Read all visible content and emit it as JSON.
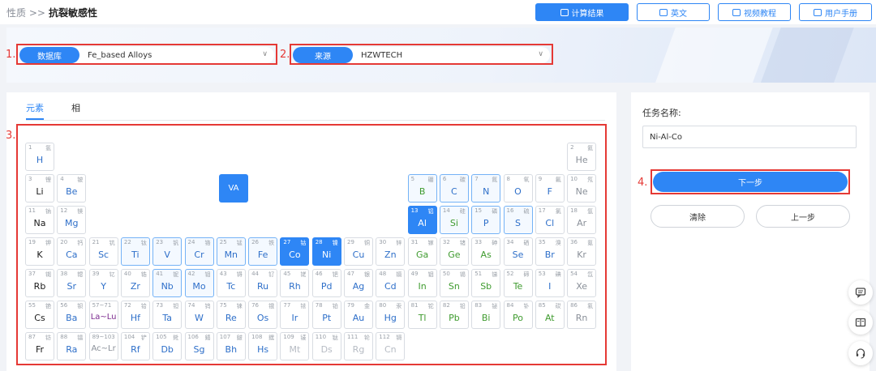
{
  "breadcrumb": {
    "parent": "性质 >>",
    "current": "抗裂敏感性"
  },
  "toolbar": {
    "calc": "计算结果",
    "english": "英文",
    "video": "视频教程",
    "manual": "用户手册"
  },
  "steps": {
    "s1": "1.",
    "s2": "2.",
    "s3": "3.",
    "s4": "4."
  },
  "database": {
    "label": "数据库",
    "value": "Fe_based Alloys"
  },
  "source": {
    "label": "来源",
    "value": "HZWTECH"
  },
  "tabs": {
    "elements": "元素",
    "phase": "相"
  },
  "va_button": "VA",
  "task": {
    "label": "任务名称:",
    "value": "Ni-Al-Co"
  },
  "actions": {
    "next": "下一步",
    "clear": "清除",
    "prev": "上一步"
  },
  "colors": {
    "accent": "#2e86f5",
    "alert": "#e53935"
  },
  "elements": [
    {
      "z": "1",
      "cn": "氢",
      "s": "H",
      "r": 0,
      "c": 0,
      "t": "b"
    },
    {
      "z": "2",
      "cn": "氦",
      "s": "He",
      "r": 0,
      "c": 17,
      "t": "g"
    },
    {
      "z": "3",
      "cn": "锂",
      "s": "Li",
      "r": 1,
      "c": 0,
      "t": "k"
    },
    {
      "z": "4",
      "cn": "铍",
      "s": "Be",
      "r": 1,
      "c": 1,
      "t": "b"
    },
    {
      "z": "5",
      "cn": "硼",
      "s": "B",
      "r": 1,
      "c": 12,
      "t": "gr",
      "h": 1
    },
    {
      "z": "6",
      "cn": "碳",
      "s": "C",
      "r": 1,
      "c": 13,
      "t": "b",
      "h": 1
    },
    {
      "z": "7",
      "cn": "氮",
      "s": "N",
      "r": 1,
      "c": 14,
      "t": "b",
      "h": 1
    },
    {
      "z": "8",
      "cn": "氧",
      "s": "O",
      "r": 1,
      "c": 15,
      "t": "b"
    },
    {
      "z": "9",
      "cn": "氟",
      "s": "F",
      "r": 1,
      "c": 16,
      "t": "b"
    },
    {
      "z": "10",
      "cn": "氖",
      "s": "Ne",
      "r": 1,
      "c": 17,
      "t": "g"
    },
    {
      "z": "11",
      "cn": "钠",
      "s": "Na",
      "r": 2,
      "c": 0,
      "t": "k"
    },
    {
      "z": "12",
      "cn": "镁",
      "s": "Mg",
      "r": 2,
      "c": 1,
      "t": "b"
    },
    {
      "z": "13",
      "cn": "铝",
      "s": "Al",
      "r": 2,
      "c": 12,
      "t": "w",
      "sel": 1
    },
    {
      "z": "14",
      "cn": "硅",
      "s": "Si",
      "r": 2,
      "c": 13,
      "t": "gr",
      "h": 1
    },
    {
      "z": "15",
      "cn": "磷",
      "s": "P",
      "r": 2,
      "c": 14,
      "t": "b",
      "h": 1
    },
    {
      "z": "16",
      "cn": "硫",
      "s": "S",
      "r": 2,
      "c": 15,
      "t": "b",
      "h": 1
    },
    {
      "z": "17",
      "cn": "氯",
      "s": "Cl",
      "r": 2,
      "c": 16,
      "t": "b"
    },
    {
      "z": "18",
      "cn": "氩",
      "s": "Ar",
      "r": 2,
      "c": 17,
      "t": "g"
    },
    {
      "z": "19",
      "cn": "钾",
      "s": "K",
      "r": 3,
      "c": 0,
      "t": "k"
    },
    {
      "z": "20",
      "cn": "钙",
      "s": "Ca",
      "r": 3,
      "c": 1,
      "t": "b"
    },
    {
      "z": "21",
      "cn": "钪",
      "s": "Sc",
      "r": 3,
      "c": 2,
      "t": "b"
    },
    {
      "z": "22",
      "cn": "钛",
      "s": "Ti",
      "r": 3,
      "c": 3,
      "t": "b",
      "h": 1
    },
    {
      "z": "23",
      "cn": "钒",
      "s": "V",
      "r": 3,
      "c": 4,
      "t": "b",
      "h": 1
    },
    {
      "z": "24",
      "cn": "铬",
      "s": "Cr",
      "r": 3,
      "c": 5,
      "t": "b",
      "h": 1
    },
    {
      "z": "25",
      "cn": "锰",
      "s": "Mn",
      "r": 3,
      "c": 6,
      "t": "b",
      "h": 1
    },
    {
      "z": "26",
      "cn": "铁",
      "s": "Fe",
      "r": 3,
      "c": 7,
      "t": "b",
      "h": 1
    },
    {
      "z": "27",
      "cn": "钴",
      "s": "Co",
      "r": 3,
      "c": 8,
      "t": "w",
      "sel": 1
    },
    {
      "z": "28",
      "cn": "镍",
      "s": "Ni",
      "r": 3,
      "c": 9,
      "t": "w",
      "sel": 1
    },
    {
      "z": "29",
      "cn": "铜",
      "s": "Cu",
      "r": 3,
      "c": 10,
      "t": "b"
    },
    {
      "z": "30",
      "cn": "锌",
      "s": "Zn",
      "r": 3,
      "c": 11,
      "t": "b"
    },
    {
      "z": "31",
      "cn": "镓",
      "s": "Ga",
      "r": 3,
      "c": 12,
      "t": "gr"
    },
    {
      "z": "32",
      "cn": "锗",
      "s": "Ge",
      "r": 3,
      "c": 13,
      "t": "gr"
    },
    {
      "z": "33",
      "cn": "砷",
      "s": "As",
      "r": 3,
      "c": 14,
      "t": "gr"
    },
    {
      "z": "34",
      "cn": "硒",
      "s": "Se",
      "r": 3,
      "c": 15,
      "t": "b"
    },
    {
      "z": "35",
      "cn": "溴",
      "s": "Br",
      "r": 3,
      "c": 16,
      "t": "b"
    },
    {
      "z": "36",
      "cn": "氪",
      "s": "Kr",
      "r": 3,
      "c": 17,
      "t": "g"
    },
    {
      "z": "37",
      "cn": "铷",
      "s": "Rb",
      "r": 4,
      "c": 0,
      "t": "k"
    },
    {
      "z": "38",
      "cn": "锶",
      "s": "Sr",
      "r": 4,
      "c": 1,
      "t": "b"
    },
    {
      "z": "39",
      "cn": "钇",
      "s": "Y",
      "r": 4,
      "c": 2,
      "t": "b"
    },
    {
      "z": "40",
      "cn": "锆",
      "s": "Zr",
      "r": 4,
      "c": 3,
      "t": "b"
    },
    {
      "z": "41",
      "cn": "铌",
      "s": "Nb",
      "r": 4,
      "c": 4,
      "t": "b",
      "h": 1
    },
    {
      "z": "42",
      "cn": "钼",
      "s": "Mo",
      "r": 4,
      "c": 5,
      "t": "b",
      "h": 1
    },
    {
      "z": "43",
      "cn": "锝",
      "s": "Tc",
      "r": 4,
      "c": 6,
      "t": "b"
    },
    {
      "z": "44",
      "cn": "钌",
      "s": "Ru",
      "r": 4,
      "c": 7,
      "t": "b"
    },
    {
      "z": "45",
      "cn": "铑",
      "s": "Rh",
      "r": 4,
      "c": 8,
      "t": "b"
    },
    {
      "z": "46",
      "cn": "钯",
      "s": "Pd",
      "r": 4,
      "c": 9,
      "t": "b"
    },
    {
      "z": "47",
      "cn": "银",
      "s": "Ag",
      "r": 4,
      "c": 10,
      "t": "b"
    },
    {
      "z": "48",
      "cn": "镉",
      "s": "Cd",
      "r": 4,
      "c": 11,
      "t": "b"
    },
    {
      "z": "49",
      "cn": "铟",
      "s": "In",
      "r": 4,
      "c": 12,
      "t": "gr"
    },
    {
      "z": "50",
      "cn": "锡",
      "s": "Sn",
      "r": 4,
      "c": 13,
      "t": "gr"
    },
    {
      "z": "51",
      "cn": "锑",
      "s": "Sb",
      "r": 4,
      "c": 14,
      "t": "gr"
    },
    {
      "z": "52",
      "cn": "碲",
      "s": "Te",
      "r": 4,
      "c": 15,
      "t": "gr"
    },
    {
      "z": "53",
      "cn": "碘",
      "s": "I",
      "r": 4,
      "c": 16,
      "t": "b"
    },
    {
      "z": "54",
      "cn": "氙",
      "s": "Xe",
      "r": 4,
      "c": 17,
      "t": "g"
    },
    {
      "z": "55",
      "cn": "铯",
      "s": "Cs",
      "r": 5,
      "c": 0,
      "t": "k"
    },
    {
      "z": "56",
      "cn": "钡",
      "s": "Ba",
      "r": 5,
      "c": 1,
      "t": "b"
    },
    {
      "z": "57~71",
      "cn": "",
      "s": "La~Lu",
      "r": 5,
      "c": 2,
      "t": "p"
    },
    {
      "z": "72",
      "cn": "铪",
      "s": "Hf",
      "r": 5,
      "c": 3,
      "t": "b"
    },
    {
      "z": "73",
      "cn": "钽",
      "s": "Ta",
      "r": 5,
      "c": 4,
      "t": "b"
    },
    {
      "z": "74",
      "cn": "钨",
      "s": "W",
      "r": 5,
      "c": 5,
      "t": "b"
    },
    {
      "z": "75",
      "cn": "铼",
      "s": "Re",
      "r": 5,
      "c": 6,
      "t": "b"
    },
    {
      "z": "76",
      "cn": "锇",
      "s": "Os",
      "r": 5,
      "c": 7,
      "t": "b"
    },
    {
      "z": "77",
      "cn": "铱",
      "s": "Ir",
      "r": 5,
      "c": 8,
      "t": "b"
    },
    {
      "z": "78",
      "cn": "铂",
      "s": "Pt",
      "r": 5,
      "c": 9,
      "t": "b"
    },
    {
      "z": "79",
      "cn": "金",
      "s": "Au",
      "r": 5,
      "c": 10,
      "t": "b"
    },
    {
      "z": "80",
      "cn": "汞",
      "s": "Hg",
      "r": 5,
      "c": 11,
      "t": "b"
    },
    {
      "z": "81",
      "cn": "铊",
      "s": "Tl",
      "r": 5,
      "c": 12,
      "t": "gr"
    },
    {
      "z": "82",
      "cn": "铅",
      "s": "Pb",
      "r": 5,
      "c": 13,
      "t": "gr"
    },
    {
      "z": "83",
      "cn": "铋",
      "s": "Bi",
      "r": 5,
      "c": 14,
      "t": "gr"
    },
    {
      "z": "84",
      "cn": "钋",
      "s": "Po",
      "r": 5,
      "c": 15,
      "t": "gr"
    },
    {
      "z": "85",
      "cn": "砹",
      "s": "At",
      "r": 5,
      "c": 16,
      "t": "gr"
    },
    {
      "z": "86",
      "cn": "氡",
      "s": "Rn",
      "r": 5,
      "c": 17,
      "t": "g"
    },
    {
      "z": "87",
      "cn": "钫",
      "s": "Fr",
      "r": 6,
      "c": 0,
      "t": "k"
    },
    {
      "z": "88",
      "cn": "镭",
      "s": "Ra",
      "r": 6,
      "c": 1,
      "t": "b"
    },
    {
      "z": "89~103",
      "cn": "",
      "s": "Ac~Lr",
      "r": 6,
      "c": 2,
      "t": "g"
    },
    {
      "z": "104",
      "cn": "铲",
      "s": "Rf",
      "r": 6,
      "c": 3,
      "t": "b"
    },
    {
      "z": "105",
      "cn": "𨧀",
      "s": "Db",
      "r": 6,
      "c": 4,
      "t": "b"
    },
    {
      "z": "106",
      "cn": "𨭎",
      "s": "Sg",
      "r": 6,
      "c": 5,
      "t": "b"
    },
    {
      "z": "107",
      "cn": "𨨏",
      "s": "Bh",
      "r": 6,
      "c": 6,
      "t": "b"
    },
    {
      "z": "108",
      "cn": "𨭆",
      "s": "Hs",
      "r": 6,
      "c": 7,
      "t": "b"
    },
    {
      "z": "109",
      "cn": "鿏",
      "s": "Mt",
      "r": 6,
      "c": 8,
      "t": "l"
    },
    {
      "z": "110",
      "cn": "𫟼",
      "s": "Ds",
      "r": 6,
      "c": 9,
      "t": "l"
    },
    {
      "z": "111",
      "cn": "𬬭",
      "s": "Rg",
      "r": 6,
      "c": 10,
      "t": "l"
    },
    {
      "z": "112",
      "cn": "鿔",
      "s": "Cn",
      "r": 6,
      "c": 11,
      "t": "l"
    }
  ]
}
